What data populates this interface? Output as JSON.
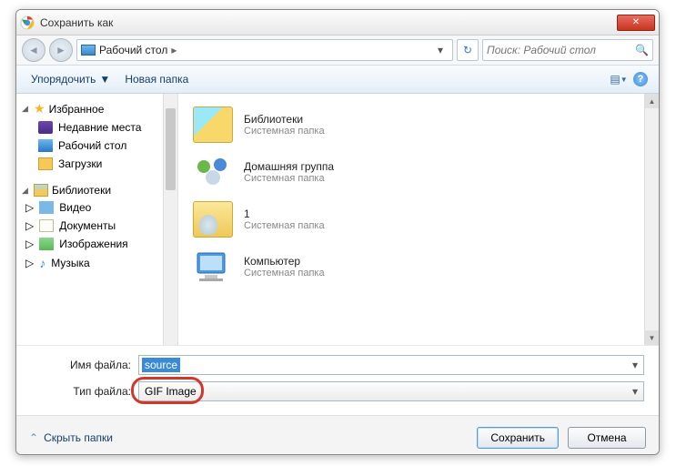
{
  "titlebar": {
    "title": "Сохранить как"
  },
  "nav": {
    "breadcrumb": "Рабочий стол",
    "search_placeholder": "Поиск: Рабочий стол"
  },
  "toolbar": {
    "organize": "Упорядочить",
    "new_folder": "Новая папка"
  },
  "tree": {
    "favorites": "Избранное",
    "recent": "Недавние места",
    "desktop": "Рабочий стол",
    "downloads": "Загрузки",
    "libraries": "Библиотеки",
    "video": "Видео",
    "documents": "Документы",
    "images": "Изображения",
    "music": "Музыка"
  },
  "list": {
    "items": [
      {
        "name": "Библиотеки",
        "sub": "Системная папка"
      },
      {
        "name": "Домашняя группа",
        "sub": "Системная папка"
      },
      {
        "name": "1",
        "sub": "Системная папка"
      },
      {
        "name": "Компьютер",
        "sub": "Системная папка"
      }
    ]
  },
  "fields": {
    "filename_label": "Имя файла:",
    "filename_value": "source",
    "filetype_label": "Тип файла:",
    "filetype_value": "GIF Image"
  },
  "footer": {
    "hide_folders": "Скрыть папки",
    "save": "Сохранить",
    "cancel": "Отмена"
  }
}
